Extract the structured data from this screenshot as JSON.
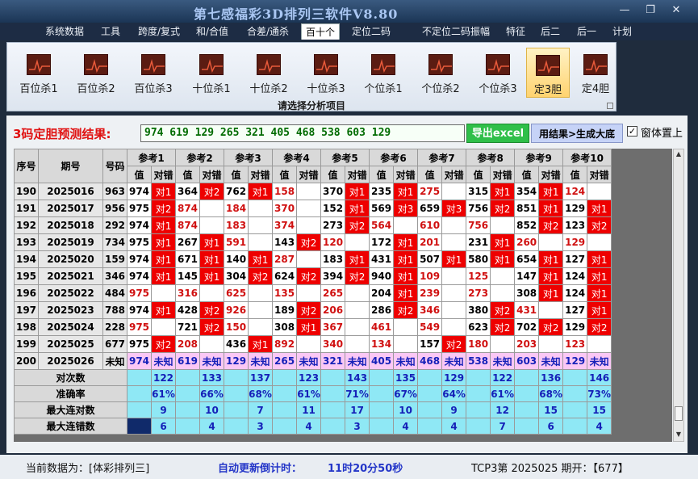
{
  "window": {
    "title": "第七感福彩3D排列三软件V8.80",
    "controls": {
      "minimize": "—",
      "maximize": "❐",
      "close": "✕"
    }
  },
  "menu": [
    "系统数据",
    "工具",
    "跨度/复式",
    "和/合值",
    "合差/通杀",
    "百十个",
    "定位二码",
    "不定位二码",
    "振幅",
    "特征",
    "后二",
    "后一",
    "计划"
  ],
  "menu_active": "百十个",
  "ribbon": {
    "buttons": [
      "百位杀1",
      "百位杀2",
      "百位杀3",
      "十位杀1",
      "十位杀2",
      "十位杀3",
      "个位杀1",
      "个位杀2",
      "个位杀3",
      "定3胆",
      "定4胆"
    ],
    "selected": "定3胆",
    "caption": "请选择分析项目"
  },
  "result": {
    "label": "3码定胆预测结果:",
    "numbers": "974 619 129 265 321 405 468 538 603 129",
    "export_button": "导出excel",
    "generate_button": "用结果>生成大底",
    "topmost_checked": true,
    "topmost_mark": "✓",
    "topmost_label": "窗体置上"
  },
  "table": {
    "headers": {
      "seq": "序号",
      "period": "期号",
      "code": "号码",
      "ref_names": [
        "参考1",
        "参考2",
        "参考3",
        "参考4",
        "参考5",
        "参考6",
        "参考7",
        "参考8",
        "参考9",
        "参考10"
      ],
      "value": "值",
      "judge": "对错"
    },
    "rows": [
      {
        "seq": "190",
        "period": "2025016",
        "code": "963",
        "refs": [
          [
            "974",
            "对1"
          ],
          [
            "364",
            "对2"
          ],
          [
            "762",
            "对1"
          ],
          [
            "158",
            ""
          ],
          [
            "370",
            "对1"
          ],
          [
            "235",
            "对1"
          ],
          [
            "275",
            ""
          ],
          [
            "315",
            "对1"
          ],
          [
            "354",
            "对1"
          ],
          [
            "124",
            ""
          ]
        ]
      },
      {
        "seq": "191",
        "period": "2025017",
        "code": "956",
        "refs": [
          [
            "975",
            "对2"
          ],
          [
            "874",
            ""
          ],
          [
            "184",
            ""
          ],
          [
            "370",
            ""
          ],
          [
            "152",
            "对1"
          ],
          [
            "569",
            "对3"
          ],
          [
            "659",
            "对3"
          ],
          [
            "756",
            "对2"
          ],
          [
            "851",
            "对1"
          ],
          [
            "129",
            "对1"
          ]
        ]
      },
      {
        "seq": "192",
        "period": "2025018",
        "code": "292",
        "refs": [
          [
            "974",
            "对1"
          ],
          [
            "874",
            ""
          ],
          [
            "183",
            ""
          ],
          [
            "374",
            ""
          ],
          [
            "273",
            "对2"
          ],
          [
            "564",
            ""
          ],
          [
            "610",
            ""
          ],
          [
            "756",
            ""
          ],
          [
            "852",
            "对2"
          ],
          [
            "123",
            "对2"
          ]
        ]
      },
      {
        "seq": "193",
        "period": "2025019",
        "code": "734",
        "refs": [
          [
            "975",
            "对1"
          ],
          [
            "267",
            "对1"
          ],
          [
            "591",
            ""
          ],
          [
            "143",
            "对2"
          ],
          [
            "120",
            ""
          ],
          [
            "172",
            "对1"
          ],
          [
            "201",
            ""
          ],
          [
            "231",
            "对1"
          ],
          [
            "260",
            ""
          ],
          [
            "129",
            ""
          ]
        ]
      },
      {
        "seq": "194",
        "period": "2025020",
        "code": "159",
        "refs": [
          [
            "974",
            "对1"
          ],
          [
            "671",
            "对1"
          ],
          [
            "140",
            "对1"
          ],
          [
            "287",
            ""
          ],
          [
            "183",
            "对1"
          ],
          [
            "431",
            "对1"
          ],
          [
            "507",
            "对1"
          ],
          [
            "580",
            "对1"
          ],
          [
            "654",
            "对1"
          ],
          [
            "127",
            "对1"
          ]
        ]
      },
      {
        "seq": "195",
        "period": "2025021",
        "code": "346",
        "refs": [
          [
            "974",
            "对1"
          ],
          [
            "145",
            "对1"
          ],
          [
            "304",
            "对2"
          ],
          [
            "624",
            "对2"
          ],
          [
            "394",
            "对2"
          ],
          [
            "940",
            "对1"
          ],
          [
            "109",
            ""
          ],
          [
            "125",
            ""
          ],
          [
            "147",
            "对1"
          ],
          [
            "124",
            "对1"
          ]
        ]
      },
      {
        "seq": "196",
        "period": "2025022",
        "code": "484",
        "refs": [
          [
            "975",
            ""
          ],
          [
            "316",
            ""
          ],
          [
            "625",
            ""
          ],
          [
            "135",
            ""
          ],
          [
            "265",
            ""
          ],
          [
            "204",
            "对1"
          ],
          [
            "239",
            ""
          ],
          [
            "273",
            ""
          ],
          [
            "308",
            "对1"
          ],
          [
            "124",
            "对1"
          ]
        ]
      },
      {
        "seq": "197",
        "period": "2025023",
        "code": "788",
        "refs": [
          [
            "974",
            "对1"
          ],
          [
            "428",
            "对2"
          ],
          [
            "926",
            ""
          ],
          [
            "189",
            "对2"
          ],
          [
            "206",
            ""
          ],
          [
            "286",
            "对2"
          ],
          [
            "346",
            ""
          ],
          [
            "380",
            "对2"
          ],
          [
            "431",
            ""
          ],
          [
            "127",
            "对1"
          ]
        ]
      },
      {
        "seq": "198",
        "period": "2025024",
        "code": "228",
        "refs": [
          [
            "975",
            ""
          ],
          [
            "721",
            "对2"
          ],
          [
            "150",
            ""
          ],
          [
            "308",
            "对1"
          ],
          [
            "367",
            ""
          ],
          [
            "461",
            ""
          ],
          [
            "549",
            ""
          ],
          [
            "623",
            "对2"
          ],
          [
            "702",
            "对2"
          ],
          [
            "129",
            "对2"
          ]
        ]
      },
      {
        "seq": "199",
        "period": "2025025",
        "code": "677",
        "refs": [
          [
            "975",
            "对2"
          ],
          [
            "208",
            ""
          ],
          [
            "436",
            "对1"
          ],
          [
            "892",
            ""
          ],
          [
            "340",
            ""
          ],
          [
            "134",
            ""
          ],
          [
            "157",
            "对2"
          ],
          [
            "180",
            ""
          ],
          [
            "203",
            ""
          ],
          [
            "123",
            ""
          ]
        ]
      }
    ],
    "forecast": {
      "seq": "200",
      "period": "2025026",
      "code": "未知",
      "values": [
        "974",
        "619",
        "129",
        "265",
        "321",
        "405",
        "468",
        "538",
        "603",
        "129"
      ],
      "judge": "未知"
    },
    "stats": [
      {
        "label": "对次数",
        "values": [
          "122",
          "133",
          "137",
          "123",
          "143",
          "135",
          "129",
          "122",
          "136",
          "146"
        ]
      },
      {
        "label": "准确率",
        "values": [
          "61%",
          "66%",
          "68%",
          "61%",
          "71%",
          "67%",
          "64%",
          "61%",
          "68%",
          "73%"
        ]
      },
      {
        "label": "最大连对数",
        "values": [
          "9",
          "10",
          "7",
          "11",
          "17",
          "10",
          "9",
          "12",
          "15",
          "15"
        ]
      },
      {
        "label": "最大连错数",
        "values": [
          "6",
          "4",
          "3",
          "4",
          "3",
          "4",
          "4",
          "7",
          "6",
          "4"
        ]
      }
    ]
  },
  "status": {
    "data_label": "当前数据为：[体彩排列三]",
    "timer_label": "自动更新倒计时：",
    "timer_value": "11时20分50秒",
    "issue": "TCP3第 2025025 期开：【677】"
  },
  "colors": {
    "hit": "#ee0000",
    "forecast_row": "#fbc8f5",
    "stats_row": "#8fe8f5",
    "excel_button": "#2fbf49"
  }
}
